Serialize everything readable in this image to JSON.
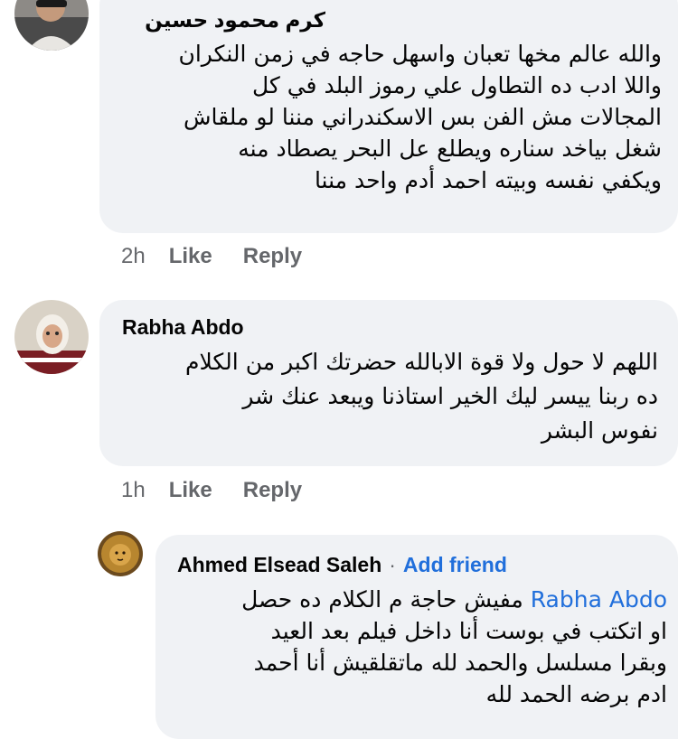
{
  "comments": [
    {
      "author": "كرم محمود حسين",
      "lines": [
        "والله عالم مخها تعبان واسهل حاجه في زمن النكران",
        "واللا ادب ده التطاول علي رموز البلد في كل",
        "المجالات مش الفن بس الاسكندراني مننا لو ملقاش",
        "شغل بياخد سناره ويطلع عل البحر يصطاد منه",
        "ويكفي نفسه وبيته احمد أدم واحد مننا"
      ],
      "time": "2h",
      "like_label": "Like",
      "reply_label": "Reply"
    },
    {
      "author": "Rabha Abdo",
      "lines": [
        "اللهم لا حول ولا قوة الابالله حضرتك اكبر من الكلام",
        "ده ربنا ييسر ليك الخير استاذنا ويبعد عنك شر",
        "نفوس البشر"
      ],
      "time": "1h",
      "like_label": "Like",
      "reply_label": "Reply"
    }
  ],
  "reply": {
    "author": "Ahmed Elsead Saleh",
    "separator": "·",
    "add_friend_label": "Add friend",
    "mention": "Rabha Abdo",
    "first_line_rest": " مفيش حاجة م الكلام ده حصل",
    "lines": [
      "او اتكتب في بوست أنا داخل فيلم بعد العيد",
      "وبقرا مسلسل والحمد لله ماتقلقيش أنا أحمد",
      "ادم برضه الحمد لله"
    ]
  },
  "colors": {
    "bubble": "#f0f2f5",
    "meta_text": "#65676b",
    "link": "#216fdb"
  }
}
